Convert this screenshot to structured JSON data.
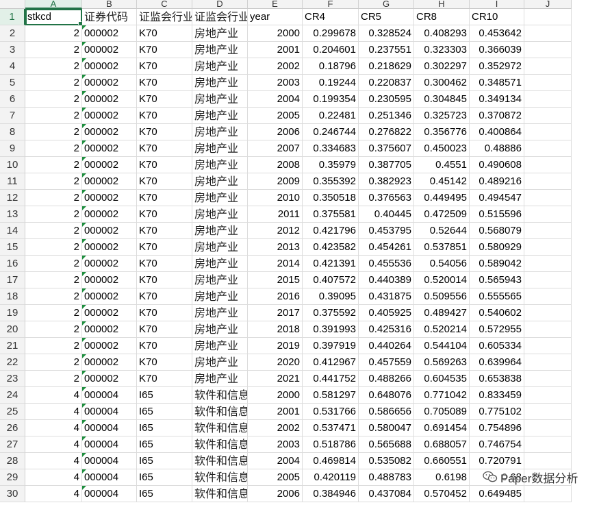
{
  "columns": [
    "A",
    "B",
    "C",
    "D",
    "E",
    "F",
    "G",
    "H",
    "I",
    "J"
  ],
  "active_column": "A",
  "active_row": 1,
  "header_row": [
    "stkcd",
    "证券代码",
    "证监会行业",
    "证监会行业",
    "year",
    "CR4",
    "CR5",
    "CR8",
    "CR10",
    ""
  ],
  "rows": [
    {
      "num": "2",
      "stkcd": "2",
      "code": "000002",
      "ind_code": "K70",
      "ind_name": "房地产业",
      "year": "2000",
      "cr4": "0.299678",
      "cr5": "0.328524",
      "cr8": "0.408293",
      "cr10": "0.453642"
    },
    {
      "num": "3",
      "stkcd": "2",
      "code": "000002",
      "ind_code": "K70",
      "ind_name": "房地产业",
      "year": "2001",
      "cr4": "0.204601",
      "cr5": "0.237551",
      "cr8": "0.323303",
      "cr10": "0.366039"
    },
    {
      "num": "4",
      "stkcd": "2",
      "code": "000002",
      "ind_code": "K70",
      "ind_name": "房地产业",
      "year": "2002",
      "cr4": "0.18796",
      "cr5": "0.218629",
      "cr8": "0.302297",
      "cr10": "0.352972"
    },
    {
      "num": "5",
      "stkcd": "2",
      "code": "000002",
      "ind_code": "K70",
      "ind_name": "房地产业",
      "year": "2003",
      "cr4": "0.19244",
      "cr5": "0.220837",
      "cr8": "0.300462",
      "cr10": "0.348571"
    },
    {
      "num": "6",
      "stkcd": "2",
      "code": "000002",
      "ind_code": "K70",
      "ind_name": "房地产业",
      "year": "2004",
      "cr4": "0.199354",
      "cr5": "0.230595",
      "cr8": "0.304845",
      "cr10": "0.349134"
    },
    {
      "num": "7",
      "stkcd": "2",
      "code": "000002",
      "ind_code": "K70",
      "ind_name": "房地产业",
      "year": "2005",
      "cr4": "0.22481",
      "cr5": "0.251346",
      "cr8": "0.325723",
      "cr10": "0.370872"
    },
    {
      "num": "8",
      "stkcd": "2",
      "code": "000002",
      "ind_code": "K70",
      "ind_name": "房地产业",
      "year": "2006",
      "cr4": "0.246744",
      "cr5": "0.276822",
      "cr8": "0.356776",
      "cr10": "0.400864"
    },
    {
      "num": "9",
      "stkcd": "2",
      "code": "000002",
      "ind_code": "K70",
      "ind_name": "房地产业",
      "year": "2007",
      "cr4": "0.334683",
      "cr5": "0.375607",
      "cr8": "0.450023",
      "cr10": "0.48886"
    },
    {
      "num": "10",
      "stkcd": "2",
      "code": "000002",
      "ind_code": "K70",
      "ind_name": "房地产业",
      "year": "2008",
      "cr4": "0.35979",
      "cr5": "0.387705",
      "cr8": "0.4551",
      "cr10": "0.490608"
    },
    {
      "num": "11",
      "stkcd": "2",
      "code": "000002",
      "ind_code": "K70",
      "ind_name": "房地产业",
      "year": "2009",
      "cr4": "0.355392",
      "cr5": "0.382923",
      "cr8": "0.45142",
      "cr10": "0.489216"
    },
    {
      "num": "12",
      "stkcd": "2",
      "code": "000002",
      "ind_code": "K70",
      "ind_name": "房地产业",
      "year": "2010",
      "cr4": "0.350518",
      "cr5": "0.376563",
      "cr8": "0.449495",
      "cr10": "0.494547"
    },
    {
      "num": "13",
      "stkcd": "2",
      "code": "000002",
      "ind_code": "K70",
      "ind_name": "房地产业",
      "year": "2011",
      "cr4": "0.375581",
      "cr5": "0.40445",
      "cr8": "0.472509",
      "cr10": "0.515596"
    },
    {
      "num": "14",
      "stkcd": "2",
      "code": "000002",
      "ind_code": "K70",
      "ind_name": "房地产业",
      "year": "2012",
      "cr4": "0.421796",
      "cr5": "0.453795",
      "cr8": "0.52644",
      "cr10": "0.568079"
    },
    {
      "num": "15",
      "stkcd": "2",
      "code": "000002",
      "ind_code": "K70",
      "ind_name": "房地产业",
      "year": "2013",
      "cr4": "0.423582",
      "cr5": "0.454261",
      "cr8": "0.537851",
      "cr10": "0.580929"
    },
    {
      "num": "16",
      "stkcd": "2",
      "code": "000002",
      "ind_code": "K70",
      "ind_name": "房地产业",
      "year": "2014",
      "cr4": "0.421391",
      "cr5": "0.455536",
      "cr8": "0.54056",
      "cr10": "0.589042"
    },
    {
      "num": "17",
      "stkcd": "2",
      "code": "000002",
      "ind_code": "K70",
      "ind_name": "房地产业",
      "year": "2015",
      "cr4": "0.407572",
      "cr5": "0.440389",
      "cr8": "0.520014",
      "cr10": "0.565943"
    },
    {
      "num": "18",
      "stkcd": "2",
      "code": "000002",
      "ind_code": "K70",
      "ind_name": "房地产业",
      "year": "2016",
      "cr4": "0.39095",
      "cr5": "0.431875",
      "cr8": "0.509556",
      "cr10": "0.555565"
    },
    {
      "num": "19",
      "stkcd": "2",
      "code": "000002",
      "ind_code": "K70",
      "ind_name": "房地产业",
      "year": "2017",
      "cr4": "0.375592",
      "cr5": "0.405925",
      "cr8": "0.489427",
      "cr10": "0.540602"
    },
    {
      "num": "20",
      "stkcd": "2",
      "code": "000002",
      "ind_code": "K70",
      "ind_name": "房地产业",
      "year": "2018",
      "cr4": "0.391993",
      "cr5": "0.425316",
      "cr8": "0.520214",
      "cr10": "0.572955"
    },
    {
      "num": "21",
      "stkcd": "2",
      "code": "000002",
      "ind_code": "K70",
      "ind_name": "房地产业",
      "year": "2019",
      "cr4": "0.397919",
      "cr5": "0.440264",
      "cr8": "0.544104",
      "cr10": "0.605334"
    },
    {
      "num": "22",
      "stkcd": "2",
      "code": "000002",
      "ind_code": "K70",
      "ind_name": "房地产业",
      "year": "2020",
      "cr4": "0.412967",
      "cr5": "0.457559",
      "cr8": "0.569263",
      "cr10": "0.639964"
    },
    {
      "num": "23",
      "stkcd": "2",
      "code": "000002",
      "ind_code": "K70",
      "ind_name": "房地产业",
      "year": "2021",
      "cr4": "0.441752",
      "cr5": "0.488266",
      "cr8": "0.604535",
      "cr10": "0.653838"
    },
    {
      "num": "24",
      "stkcd": "4",
      "code": "000004",
      "ind_code": "I65",
      "ind_name": "软件和信息",
      "year": "2000",
      "cr4": "0.581297",
      "cr5": "0.648076",
      "cr8": "0.771042",
      "cr10": "0.833459"
    },
    {
      "num": "25",
      "stkcd": "4",
      "code": "000004",
      "ind_code": "I65",
      "ind_name": "软件和信息",
      "year": "2001",
      "cr4": "0.531766",
      "cr5": "0.586656",
      "cr8": "0.705089",
      "cr10": "0.775102"
    },
    {
      "num": "26",
      "stkcd": "4",
      "code": "000004",
      "ind_code": "I65",
      "ind_name": "软件和信息",
      "year": "2002",
      "cr4": "0.537471",
      "cr5": "0.580047",
      "cr8": "0.691454",
      "cr10": "0.754896"
    },
    {
      "num": "27",
      "stkcd": "4",
      "code": "000004",
      "ind_code": "I65",
      "ind_name": "软件和信息",
      "year": "2003",
      "cr4": "0.518786",
      "cr5": "0.565688",
      "cr8": "0.688057",
      "cr10": "0.746754"
    },
    {
      "num": "28",
      "stkcd": "4",
      "code": "000004",
      "ind_code": "I65",
      "ind_name": "软件和信息",
      "year": "2004",
      "cr4": "0.469814",
      "cr5": "0.535082",
      "cr8": "0.660551",
      "cr10": "0.720791"
    },
    {
      "num": "29",
      "stkcd": "4",
      "code": "000004",
      "ind_code": "I65",
      "ind_name": "软件和信息",
      "year": "2005",
      "cr4": "0.420119",
      "cr5": "0.488783",
      "cr8": "0.6198",
      "cr10": "0.68"
    },
    {
      "num": "30",
      "stkcd": "4",
      "code": "000004",
      "ind_code": "I65",
      "ind_name": "软件和信息",
      "year": "2006",
      "cr4": "0.384946",
      "cr5": "0.437084",
      "cr8": "0.570452",
      "cr10": "0.649485"
    }
  ],
  "watermark": {
    "text": "Paper数据分析",
    "icon": "wechat-icon"
  },
  "colors": {
    "accent": "#217346",
    "flag": "#1e8e3e"
  }
}
